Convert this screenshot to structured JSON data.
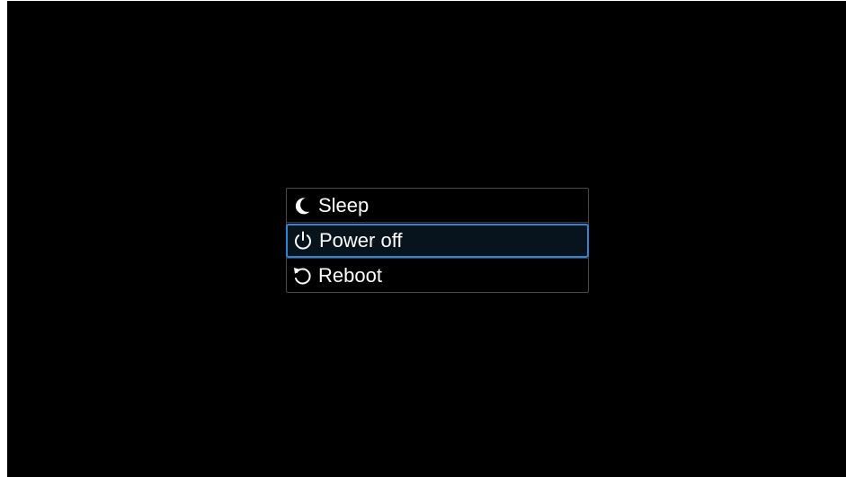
{
  "power_menu": {
    "items": [
      {
        "label": "Sleep",
        "icon": "moon-icon"
      },
      {
        "label": "Power off",
        "icon": "power-icon",
        "selected": true
      },
      {
        "label": "Reboot",
        "icon": "restart-icon"
      }
    ]
  },
  "colors": {
    "background": "#000000",
    "text": "#ffffff",
    "highlight_border": "#2f86d6"
  }
}
